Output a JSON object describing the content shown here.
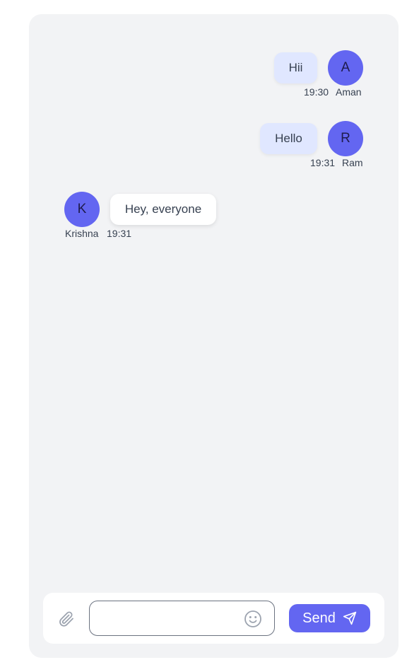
{
  "messages": [
    {
      "text": "Hii",
      "time": "19:30",
      "sender": "Aman",
      "initial": "A",
      "direction": "outgoing"
    },
    {
      "text": "Hello",
      "time": "19:31",
      "sender": "Ram",
      "initial": "R",
      "direction": "outgoing"
    },
    {
      "text": "Hey, everyone",
      "time": "19:31",
      "sender": "Krishna",
      "initial": "K",
      "direction": "incoming"
    }
  ],
  "composer": {
    "placeholder": "",
    "value": "",
    "send_label": "Send",
    "icons": {
      "attach": "paperclip-icon",
      "emoji": "smiley-icon",
      "send": "paper-plane-icon"
    }
  },
  "colors": {
    "accent": "#6366f1",
    "panel_bg": "#f2f3f5",
    "outgoing_bubble": "#e0e7ff",
    "incoming_bubble": "#ffffff"
  }
}
